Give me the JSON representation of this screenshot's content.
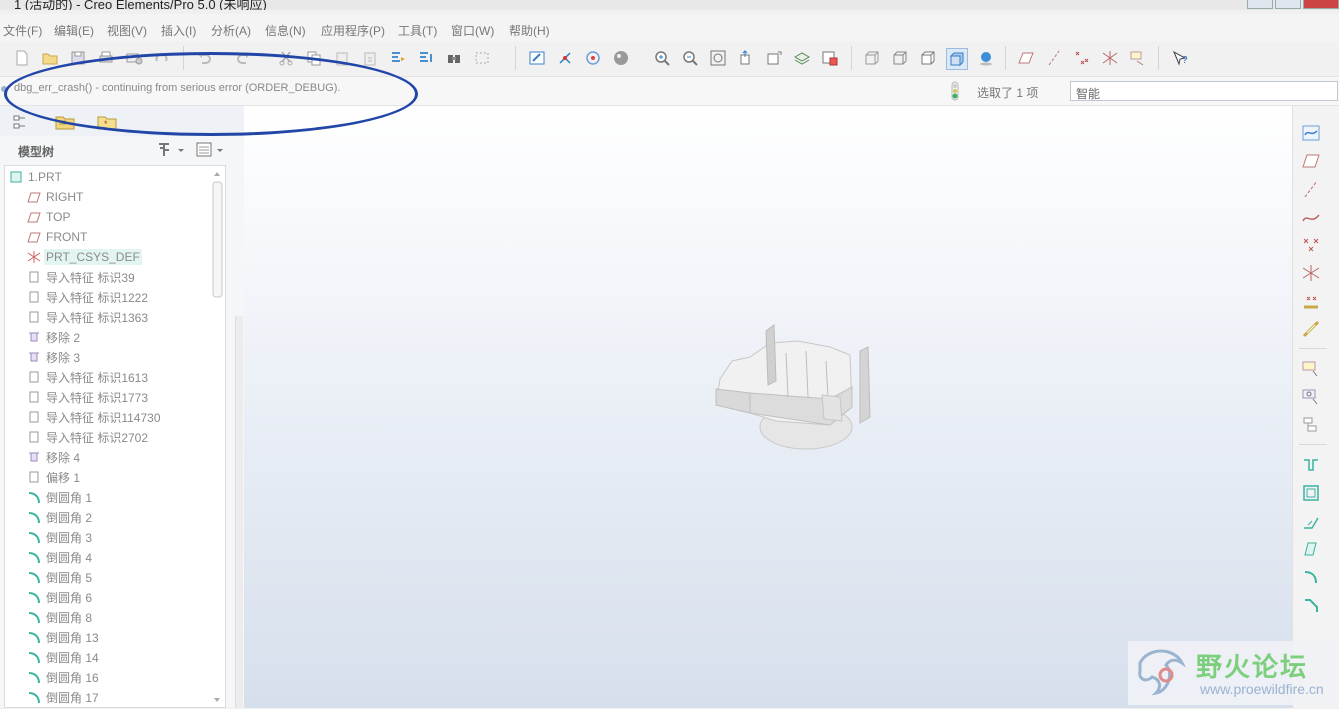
{
  "window": {
    "title": "1 (活动的) - Creo Elements/Pro 5.0 (未响应)"
  },
  "menu": [
    "文件(F)",
    "编辑(E)",
    "视图(V)",
    "插入(I)",
    "分析(A)",
    "信息(N)",
    "应用程序(P)",
    "工具(T)",
    "窗口(W)",
    "帮助(H)"
  ],
  "message": {
    "text": "dbg_err_crash() - continuing from serious error (ORDER_DEBUG).",
    "selection": "选取了 1 项"
  },
  "filter": {
    "value": "智能"
  },
  "tree": {
    "header": "模型树",
    "items": [
      "1.PRT",
      "RIGHT",
      "TOP",
      "FRONT",
      "PRT_CSYS_DEF",
      "导入特征 标识39",
      "导入特征 标识1222",
      "导入特征 标识1363",
      "移除 2",
      "移除 3",
      "导入特征 标识1613",
      "导入特征 标识1773",
      "导入特征 标识114730",
      "导入特征 标识2702",
      "移除 4",
      "偏移 1",
      "倒圆角 1",
      "倒圆角 2",
      "倒圆角 3",
      "倒圆角 4",
      "倒圆角 5",
      "倒圆角 6",
      "倒圆角 8",
      "倒圆角 13",
      "倒圆角 14",
      "倒圆角 16",
      "倒圆角 17"
    ]
  },
  "watermark": {
    "cn": "野火论坛",
    "url": "www.proewildfire.cn"
  },
  "colors": {
    "annotation": "#2246a8",
    "accent": "#3bb3a0"
  }
}
